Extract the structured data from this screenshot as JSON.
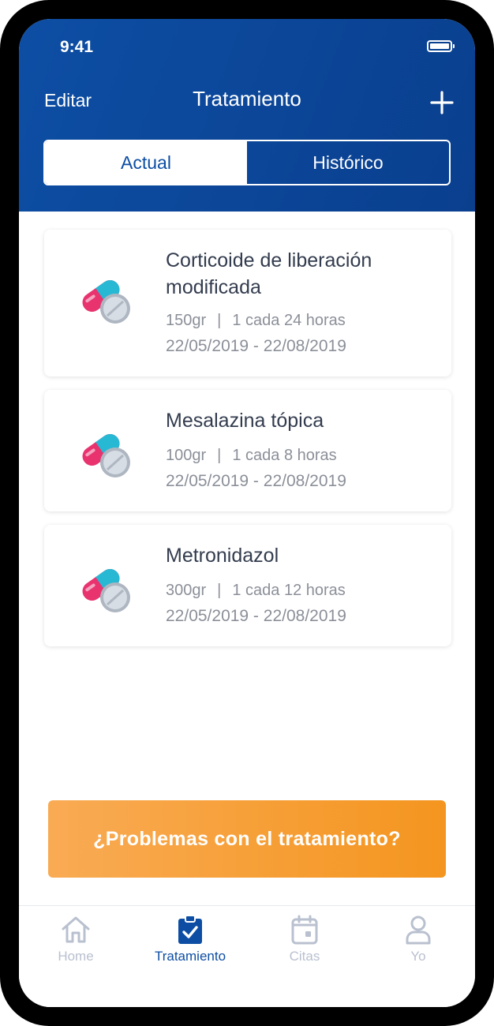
{
  "status_bar": {
    "time": "9:41"
  },
  "header": {
    "edit_label": "Editar",
    "title": "Tratamiento"
  },
  "segments": [
    {
      "label": "Actual",
      "active": true
    },
    {
      "label": "Histórico",
      "active": false
    }
  ],
  "medications": [
    {
      "name": "Corticoide de liberación modificada",
      "dose": "150gr",
      "frequency": "1 cada 24 horas",
      "dates": "22/05/2019 - 22/08/2019",
      "icon": "pill-icon"
    },
    {
      "name": "Mesalazina tópica",
      "dose": "100gr",
      "frequency": "1 cada 8 horas",
      "dates": "22/05/2019 - 22/08/2019",
      "icon": "pill-icon"
    },
    {
      "name": "Metronidazol",
      "dose": "300gr",
      "frequency": "1 cada 12 horas",
      "dates": "22/05/2019 - 22/08/2019",
      "icon": "pill-icon"
    }
  ],
  "dose_separator": "|",
  "cta_label": "¿Problemas con el tratamiento?",
  "tabs": [
    {
      "label": "Home",
      "icon": "home-icon",
      "active": false
    },
    {
      "label": "Tratamiento",
      "icon": "clipboard-check-icon",
      "active": true
    },
    {
      "label": "Citas",
      "icon": "calendar-icon",
      "active": false
    },
    {
      "label": "Yo",
      "icon": "user-icon",
      "active": false
    }
  ],
  "colors": {
    "primary": "#0d4ea4",
    "accent": "#f4951f",
    "tab_inactive": "#b9c0cf"
  }
}
